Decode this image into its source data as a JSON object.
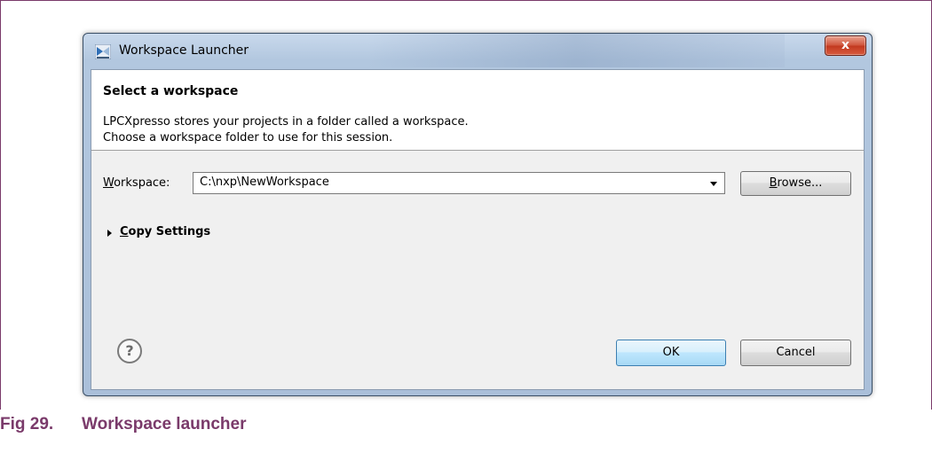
{
  "window": {
    "title": "Workspace Launcher",
    "close_glyph": "x"
  },
  "header": {
    "title": "Select a workspace",
    "desc_line1": "LPCXpresso stores your projects in a folder called a workspace.",
    "desc_line2": "Choose a workspace folder to use for this session."
  },
  "workspace": {
    "label_mnemonic": "W",
    "label_rest": "orkspace:",
    "value": "C:\\nxp\\NewWorkspace"
  },
  "buttons": {
    "browse_mnemonic": "B",
    "browse_rest": "rowse...",
    "ok": "OK",
    "cancel": "Cancel"
  },
  "copy_settings": {
    "mnemonic": "C",
    "rest": "opy Settings"
  },
  "help": {
    "glyph": "?"
  },
  "caption": {
    "number": "Fig 29.",
    "title": "Workspace launcher"
  },
  "colors": {
    "caption": "#7a3a6a",
    "close_button": "#c2391f",
    "ok_border": "#3c7fb1"
  }
}
